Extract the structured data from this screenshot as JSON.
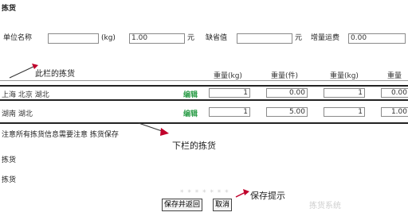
{
  "page": {
    "title": "拣货"
  },
  "form": {
    "label1": "单位名称",
    "input1": "",
    "label2": "(kg)",
    "input2": "1.00",
    "unit2": "元",
    "label3": "缺省值",
    "input3": "",
    "unit3": "元",
    "label4": "增量运费",
    "input4": "0.00"
  },
  "callout_top": "此栏的拣货",
  "table": {
    "headers": [
      "重量(kg)",
      "重量(件)",
      "重量(kg)",
      "重量"
    ],
    "rows": [
      {
        "name": "上海 北京 湖北",
        "tag": "编辑",
        "col1": "1",
        "col2": "0.00",
        "col3": "1",
        "col4": "0.00"
      },
      {
        "name": "湖南 湖北",
        "tag": "编辑",
        "col1": "1",
        "col2": "5.00",
        "col3": "1",
        "col4": "1.00"
      }
    ]
  },
  "callout_bottom": "下栏的拣货",
  "note": "注意所有拣货信息需要注意 拣货保存",
  "label_a": "拣货",
  "label_b": "拣货",
  "buttons": {
    "save": "保存并返回",
    "cancel": "取消",
    "hint": "保存提示"
  },
  "faint_above_buttons": "* * * * * * *",
  "watermark": "拣货系统",
  "colors": {
    "accent_red": "#c0002b",
    "green": "#2e9e4a"
  }
}
